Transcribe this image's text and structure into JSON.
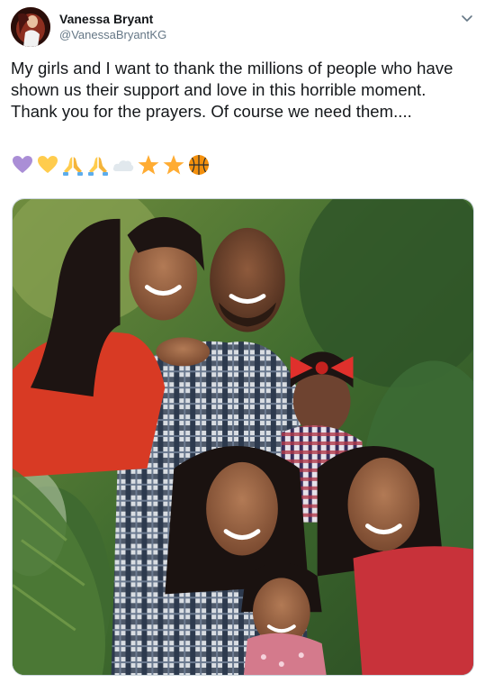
{
  "author": {
    "display_name": "Vanessa Bryant",
    "handle": "@VanessaBryantKG",
    "avatar_icon": "profile-photo"
  },
  "menu": {
    "icon": "chevron-down-icon"
  },
  "tweet": {
    "text": "My girls and I want to thank the millions of people who have shown us their support and love in this horrible moment. Thank you for the prayers. Of course we need them....",
    "emojis": [
      "purple-heart",
      "yellow-heart",
      "folded-hands",
      "folded-hands",
      "cloud",
      "star",
      "star",
      "basketball"
    ]
  },
  "media": {
    "type": "photo",
    "subject": "family portrait"
  },
  "colors": {
    "text": "#14171a",
    "secondary": "#657786",
    "border": "#ccd6dd"
  }
}
